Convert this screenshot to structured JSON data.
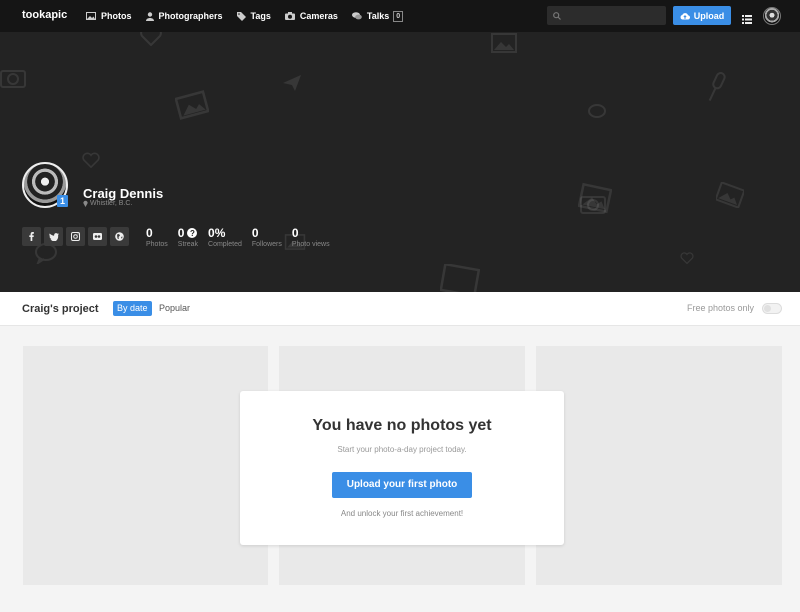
{
  "app": {
    "logo": "tookapic"
  },
  "nav": {
    "items": [
      {
        "label": "Photos",
        "icon": "image-icon"
      },
      {
        "label": "Photographers",
        "icon": "user-icon"
      },
      {
        "label": "Tags",
        "icon": "tag-icon"
      },
      {
        "label": "Cameras",
        "icon": "camera-icon"
      },
      {
        "label": "Talks",
        "icon": "chat-icon",
        "badge": "0"
      }
    ],
    "search_value": "",
    "upload_label": "Upload"
  },
  "profile": {
    "name": "Craig Dennis",
    "location": "Whistler, B.C.",
    "level": "1",
    "socials": [
      "facebook-icon",
      "twitter-icon",
      "instagram-icon",
      "flickr-icon",
      "globe-icon"
    ],
    "stats": [
      {
        "value": "0",
        "label": "Photos"
      },
      {
        "value": "0",
        "label": "Streak"
      },
      {
        "value": "0%",
        "label": "Completed"
      },
      {
        "value": "0",
        "label": "Followers"
      },
      {
        "value": "0",
        "label": "Photo views"
      }
    ],
    "streak_help": "?"
  },
  "project": {
    "title": "Craig's project",
    "tabs": [
      {
        "label": "By date",
        "active": true
      },
      {
        "label": "Popular",
        "active": false
      }
    ],
    "free_photos_label": "Free photos only",
    "free_photos_on": false
  },
  "empty_state": {
    "title": "You have no photos yet",
    "subtitle": "Start your photo-a-day project today.",
    "button": "Upload your first photo",
    "footer": "And unlock your first achievement!"
  },
  "colors": {
    "accent": "#3a8ee6",
    "topbar": "#151515",
    "hero": "#232323"
  }
}
